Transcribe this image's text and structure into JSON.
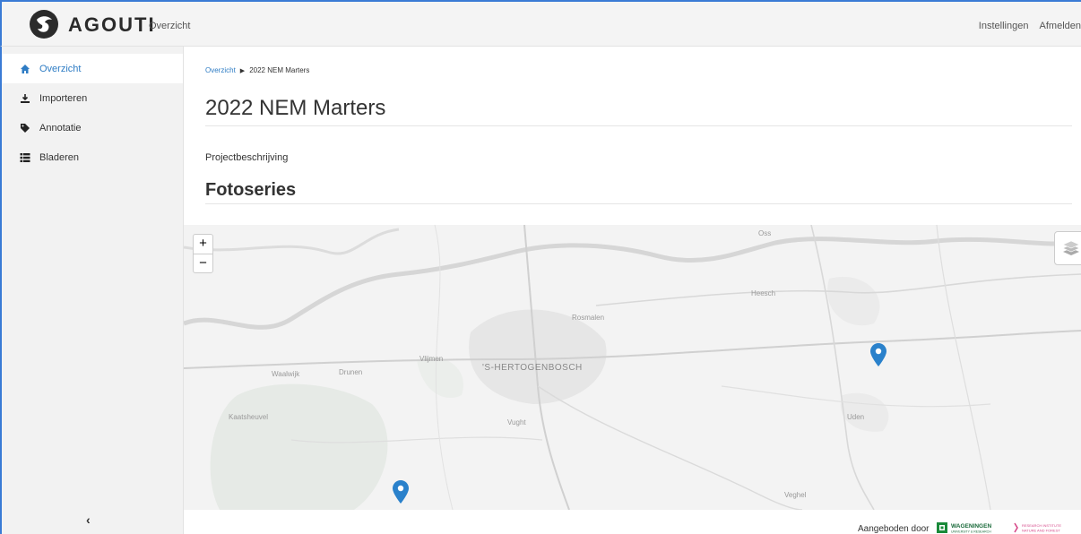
{
  "app": {
    "name": "AGOUTI",
    "nav_link": "Overzicht"
  },
  "header_right": {
    "settings": "Instellingen",
    "logout": "Afmelden"
  },
  "sidebar": {
    "items": [
      {
        "label": "Overzicht",
        "icon": "home-icon",
        "active": true
      },
      {
        "label": "Importeren",
        "icon": "import-icon",
        "active": false
      },
      {
        "label": "Annotatie",
        "icon": "tag-icon",
        "active": false
      },
      {
        "label": "Bladeren",
        "icon": "list-icon",
        "active": false
      }
    ],
    "collapse": "‹"
  },
  "breadcrumb": {
    "root": "Overzicht",
    "current": "2022 NEM Marters"
  },
  "page": {
    "title": "2022 NEM Marters",
    "description_label": "Projectbeschrijving",
    "photoseries_title": "Fotoseries"
  },
  "map": {
    "zoom_in": "+",
    "zoom_out": "−",
    "places": {
      "oss": "Oss",
      "heesch": "Heesch",
      "rosmalen": "Rosmalen",
      "vlijmen": "Vlijmen",
      "den_bosch": "'S-HERTOGENBOSCH",
      "waalwijk": "Waalwijk",
      "drunen": "Drunen",
      "kaatsheuvel": "Kaatsheuvel",
      "vught": "Vught",
      "uden": "Uden",
      "veghel": "Veghel"
    },
    "marker_color": "#2a81cb"
  },
  "footer": {
    "offered_by": "Aangeboden door",
    "logo1": "WAGENINGEN",
    "logo1_sub": "UNIVERSITY & RESEARCH",
    "logo2": "RESEARCH INSTITUTE",
    "logo2_sub": "NATURE AND FOREST"
  }
}
